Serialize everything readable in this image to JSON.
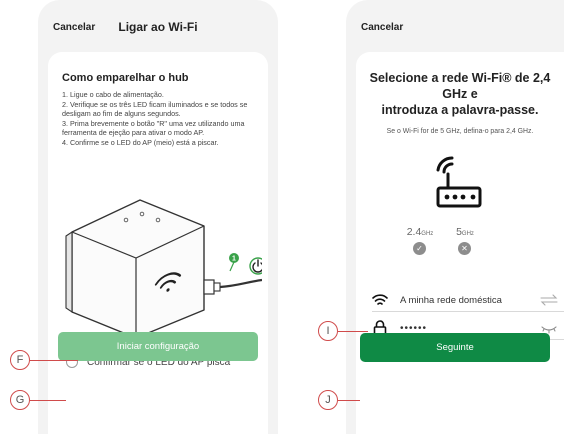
{
  "left_screen": {
    "cancel_label": "Cancelar",
    "title": "Ligar ao Wi-Fi",
    "heading": "Como emparelhar o hub",
    "steps": [
      "1. Ligue o cabo de alimentação.",
      "2. Verifique se os três LED ficam iluminados e se todos se desligam ao fim de alguns segundos.",
      "3. Prima brevemente o botão \"R\" uma vez utilizando uma ferramenta de ejeção para ativar o modo AP.",
      "4. Confirme se o LED do AP (meio) está a piscar."
    ],
    "illustration_badge": "1",
    "confirm_label": "Confirmar se o LED do AP pisca",
    "start_button": "Iniciar configuração"
  },
  "right_screen": {
    "cancel_label": "Cancelar",
    "title_line1": "Selecione a rede Wi-Fi® de 2,4 GHz e",
    "title_line2": "introduza a palavra-passe.",
    "subtitle": "Se o Wi-Fi for de 5 GHz, defina-o para 2,4 GHz.",
    "band_24": "2.4",
    "band_24_unit": "GHz",
    "band_5": "5",
    "band_5_unit": "GHz",
    "network_name": "A minha rede doméstica",
    "password_mask": "••••••",
    "next_button": "Seguinte"
  },
  "callouts": {
    "f": "F",
    "g": "G",
    "i": "I",
    "j": "J"
  },
  "colors": {
    "primary_green": "#0f8a45",
    "disabled_green": "#7cc690",
    "callout_red": "#d04b4b",
    "led_green": "#3aa24a"
  }
}
